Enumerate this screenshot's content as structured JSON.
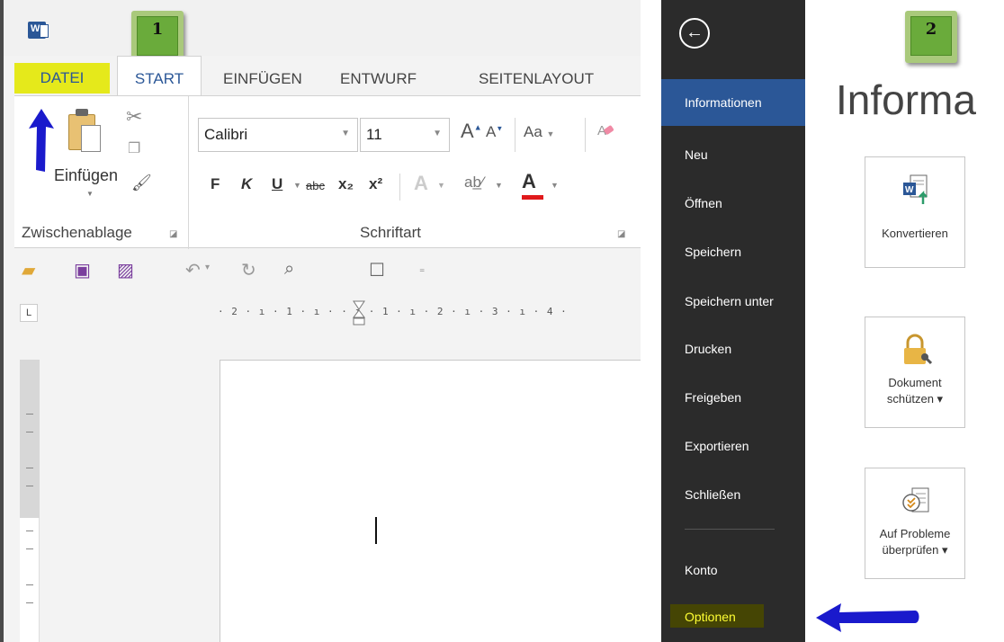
{
  "left": {
    "callout_1": "1",
    "tabs": [
      "DATEI",
      "START",
      "EINFÜGEN",
      "ENTWURF",
      "SEITENLAYOUT"
    ],
    "clipboard": {
      "paste_label": "Einfügen",
      "group_label": "Zwischenablage"
    },
    "font": {
      "name": "Calibri",
      "size": "11",
      "group_label": "Schriftart",
      "change_case": "Aa"
    },
    "format_buttons": {
      "bold": "F",
      "italic": "K",
      "underline": "U",
      "strikethrough": "abc",
      "subscript": "x₂",
      "superscript": "x²",
      "text_effect": "A",
      "font_color": "A"
    },
    "ruler_text": "· 2 · ı · 1 · ı ·   · ı · 1 · ı · 2 · ı · 3 · ı · 4 ·",
    "colors": {
      "datei_highlight": "#e5e91b",
      "accent": "#2b5797",
      "font_color_bar": "#e0191b"
    }
  },
  "backstage": {
    "callout_2": "2",
    "nav": {
      "informationen": "Informationen",
      "neu": "Neu",
      "oeffnen": "Öffnen",
      "speichern": "Speichern",
      "speichern_unter": "Speichern unter",
      "drucken": "Drucken",
      "freigeben": "Freigeben",
      "exportieren": "Exportieren",
      "schliessen": "Schließen",
      "konto": "Konto",
      "optionen": "Optionen"
    },
    "title": "Informa",
    "tiles": {
      "convert": "Konvertieren",
      "protect_1": "Dokument",
      "protect_2": "schützen ▾",
      "check_1": "Auf Probleme",
      "check_2": "überprüfen ▾"
    },
    "colors": {
      "nav_bg": "#2b2b2b",
      "selected": "#2b5797",
      "optionen_text": "#ffff33"
    }
  }
}
